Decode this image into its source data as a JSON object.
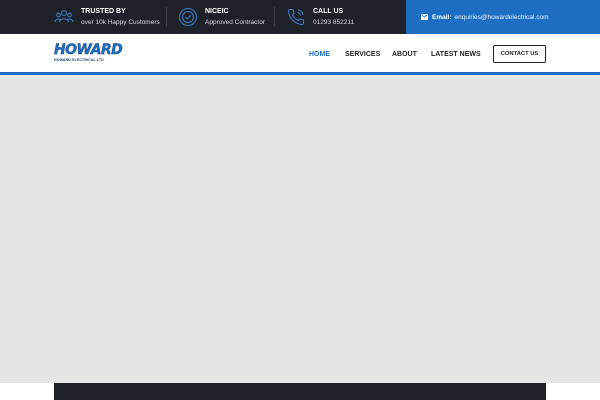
{
  "topbar": {
    "items": [
      {
        "title": "TRUSTED BY",
        "subtitle": "over 10k Happy Customers",
        "icon": "customers-icon"
      },
      {
        "title": "NICEIC",
        "subtitle": "Approved Contractor",
        "icon": "approved-badge-icon"
      },
      {
        "title": "CALL US",
        "subtitle": "01293 852211",
        "icon": "phone-icon"
      }
    ],
    "email_label": "Email:",
    "email_address": "enquiries@howardelectrical.com",
    "email_icon": "envelope-icon"
  },
  "header": {
    "logo_mark": "HOWARD",
    "logo_sub": "HOWARD ELECTRICAL LTD",
    "nav": [
      "HOME",
      "SERVICES",
      "ABOUT",
      "LATEST NEWS"
    ],
    "active_nav": "HOME",
    "contact_button": "CONTACT US"
  },
  "colors": {
    "accent": "#1e6fc4",
    "dark": "#1e2128",
    "hero_bg": "#e5e5e5"
  }
}
